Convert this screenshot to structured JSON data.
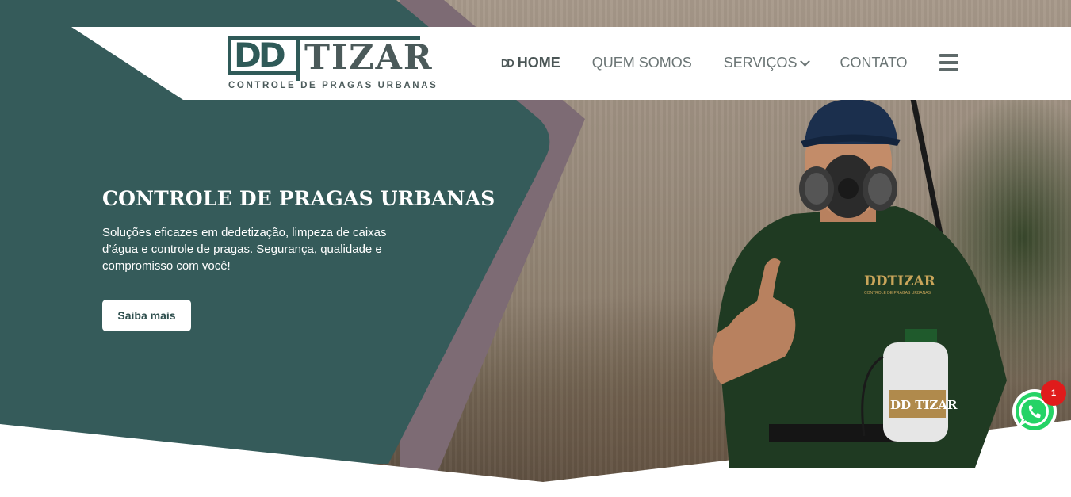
{
  "brand": {
    "logo_mark": "DD",
    "logo_name": "TIZAR",
    "logo_tagline": "CONTROLE DE PRAGAS URBANAS"
  },
  "nav": {
    "home_icon": "DD",
    "items": [
      {
        "label": "HOME",
        "active": true
      },
      {
        "label": "QUEM SOMOS",
        "active": false
      },
      {
        "label": "SERVIÇOS",
        "active": false,
        "has_dropdown": true
      },
      {
        "label": "CONTATO",
        "active": false
      }
    ],
    "menu_icon": "hamburger-menu-icon"
  },
  "hero": {
    "title": "CONTROLE DE PRAGAS URBANAS",
    "text": "Soluções eficazes em dedetização, limpeza de caixas d’água e controle de pragas. Segurança, qualidade e compromisso com você!",
    "cta_label": "Saiba mais",
    "shirt_logo": "DDTIZAR",
    "shirt_sub": "CONTROLE DE PRAGAS URBANAS",
    "sprayer_label": "DD TIZAR"
  },
  "whatsapp": {
    "icon": "whatsapp-icon",
    "badge": "1"
  },
  "colors": {
    "teal": "#355b5a",
    "mauve": "#7d6b74",
    "white": "#ffffff",
    "badge_red": "#e01b1b",
    "whatsapp_green": "#25d366"
  }
}
